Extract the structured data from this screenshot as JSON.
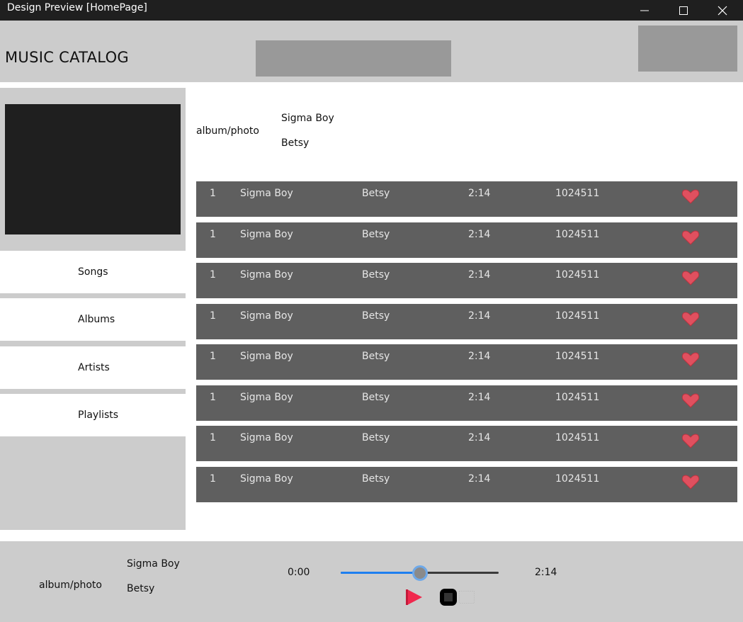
{
  "window": {
    "title": "Design Preview [HomePage]"
  },
  "header": {
    "app_title": "MUSIC CATALOG"
  },
  "sidebar": {
    "items": [
      {
        "label": "Songs"
      },
      {
        "label": "Albums"
      },
      {
        "label": "Artists"
      },
      {
        "label": "Playlists"
      }
    ]
  },
  "now_info": {
    "art_label": "album/photo",
    "song": "Sigma Boy",
    "artist": "Betsy"
  },
  "songs": [
    {
      "num": "1",
      "title": "Sigma Boy",
      "artist": "Betsy",
      "duration": "2:14",
      "plays": "1024511"
    },
    {
      "num": "1",
      "title": "Sigma Boy",
      "artist": "Betsy",
      "duration": "2:14",
      "plays": "1024511"
    },
    {
      "num": "1",
      "title": "Sigma Boy",
      "artist": "Betsy",
      "duration": "2:14",
      "plays": "1024511"
    },
    {
      "num": "1",
      "title": "Sigma Boy",
      "artist": "Betsy",
      "duration": "2:14",
      "plays": "1024511"
    },
    {
      "num": "1",
      "title": "Sigma Boy",
      "artist": "Betsy",
      "duration": "2:14",
      "plays": "1024511"
    },
    {
      "num": "1",
      "title": "Sigma Boy",
      "artist": "Betsy",
      "duration": "2:14",
      "plays": "1024511"
    },
    {
      "num": "1",
      "title": "Sigma Boy",
      "artist": "Betsy",
      "duration": "2:14",
      "plays": "1024511"
    },
    {
      "num": "1",
      "title": "Sigma Boy",
      "artist": "Betsy",
      "duration": "2:14",
      "plays": "1024511"
    }
  ],
  "player": {
    "art_label": "album/photo",
    "song": "Sigma Boy",
    "artist": "Betsy",
    "current_time": "0:00",
    "total_time": "2:14",
    "progress": 0.5
  },
  "icons": {
    "heart": "heart-icon",
    "play": "play-icon",
    "stop": "stop-icon",
    "minimize": "minimize-icon",
    "maximize": "maximize-icon",
    "close": "close-icon"
  },
  "colors": {
    "heart": "#e0505f",
    "play": "#f0284d",
    "slider_fill": "#1e7ff0",
    "row_bg": "#5f5f5f",
    "panel_bg": "#cccccc"
  }
}
